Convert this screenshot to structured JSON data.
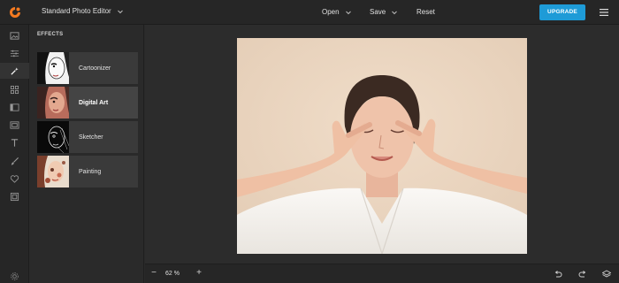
{
  "header": {
    "editor_mode": "Standard Photo Editor",
    "menu": {
      "open": "Open",
      "save": "Save",
      "reset": "Reset"
    },
    "upgrade_label": "UPGRADE",
    "brand_color": "#f47a20",
    "accent_color": "#1e9bd7"
  },
  "toolbar": {
    "tools": [
      "image-icon",
      "sliders-icon",
      "magic-wand-icon",
      "grid-icon",
      "layout-icon",
      "frame-icon",
      "text-icon",
      "brush-icon",
      "heart-icon",
      "filmstrip-icon",
      "settings-icon"
    ],
    "active": "magic-wand-icon"
  },
  "effects": {
    "title": "EFFECTS",
    "items": [
      {
        "label": "Cartoonizer"
      },
      {
        "label": "Digital Art"
      },
      {
        "label": "Sketcher"
      },
      {
        "label": "Painting"
      }
    ],
    "selected": "Digital Art"
  },
  "zoom": {
    "minus": "−",
    "value": "62 %",
    "plus": "+"
  },
  "bottom_icons": [
    "undo-icon",
    "redo-icon",
    "layers-icon"
  ]
}
